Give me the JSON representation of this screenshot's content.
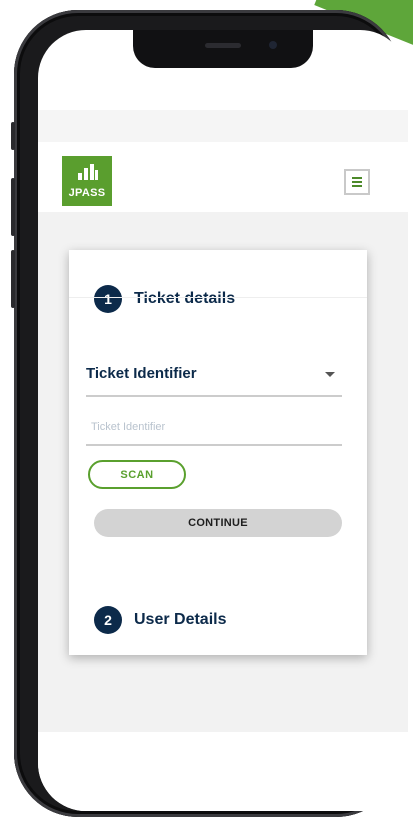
{
  "brand": {
    "logo_text": "JPASS",
    "logo_color": "#5a9e2e",
    "accent_color": "#5aa02e",
    "navy_color": "#0c2a4a"
  },
  "header": {
    "menu_icon": "hamburger-icon"
  },
  "steps": [
    {
      "number": "1",
      "title": "Ticket details"
    },
    {
      "number": "2",
      "title": "User Details"
    }
  ],
  "form": {
    "select_value": "Ticket Identifier",
    "input_placeholder": "Ticket Identifier",
    "input_value": "",
    "scan_label": "SCAN",
    "continue_label": "CONTINUE"
  }
}
